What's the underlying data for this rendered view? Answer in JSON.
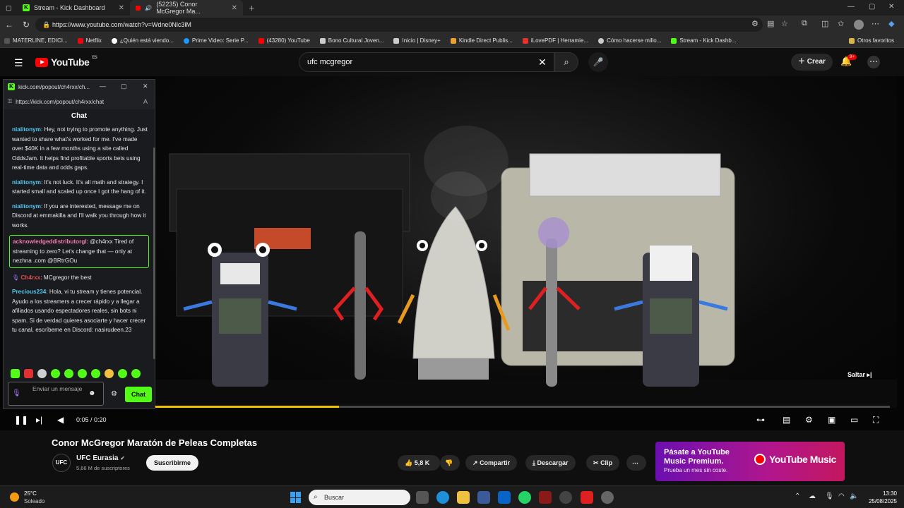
{
  "browser": {
    "tabs": [
      {
        "label": "Stream - Kick Dashboard"
      },
      {
        "label": "(52235) Conor McGregor Ma..."
      }
    ],
    "url": "https://www.youtube.com/watch?v=Wdne0Nlc3lM",
    "bookmarks": [
      {
        "label": "MATERLINE, EDICI...",
        "color": "#ff6b6b"
      },
      {
        "label": "Netflix",
        "color": "#e50914"
      },
      {
        "label": "¿Quién está viendo...",
        "color": "#ffffff"
      },
      {
        "label": "Prime Video: Serie P...",
        "color": "#1a98ff"
      },
      {
        "label": "(43280) YouTube",
        "color": "#ff0000"
      },
      {
        "label": "Bono Cultural Joven...",
        "color": "#cccccc"
      },
      {
        "label": "Inicio | Disney+",
        "color": "#cccccc"
      },
      {
        "label": "Kindle Direct Publis...",
        "color": "#f0a030"
      },
      {
        "label": "iLovePDF | Herramie...",
        "color": "#e5322d"
      },
      {
        "label": "Cómo hacerse millo...",
        "color": "#cccccc"
      },
      {
        "label": "Stream - Kick Dashb...",
        "color": "#53fc18"
      }
    ],
    "other_bookmarks": "Otros favoritos"
  },
  "youtube": {
    "logo": "YouTube",
    "region": "ES",
    "search_query": "ufc mcgregor",
    "create_label": "Crear",
    "notif_count": "9+"
  },
  "player": {
    "time": "0:05 / 0:20",
    "skip_label": "Saltar",
    "progress_fraction": 0.25
  },
  "video": {
    "title": "Conor McGregor Maratón de Peleas Completas",
    "channel": "UFC Eurasia",
    "channel_avatar": "UFC",
    "subscribers": "5,66 M de suscriptores",
    "subscribe_label": "Suscribirme",
    "likes": "5,8 K",
    "share_label": "Compartir",
    "download_label": "Descargar",
    "clip_label": "Clip"
  },
  "promo": {
    "title": "Pásate a YouTube Music Premium.",
    "subtitle": "Prueba un mes sin coste.",
    "logo": "YouTube Music"
  },
  "popup": {
    "title": "kick.com/popout/ch4rxx/ch...",
    "url": "https://kick.com/popout/ch4rxx/chat",
    "chat_title": "Chat",
    "messages": [
      {
        "user": "nialitonym",
        "color": "#53c8f0",
        "text": "Hey, not trying to promote anything. Just wanted to share what's worked for me. I've made over $40K in a few months using a site called OddsJam. It helps find profitable sports bets using real-time data and odds gaps."
      },
      {
        "user": "nialitonym",
        "color": "#53c8f0",
        "text": "It's not luck. It's all math and strategy. I started small and scaled up once I got the hang of it."
      },
      {
        "user": "nialitonym",
        "color": "#53c8f0",
        "text": "If you are interested, message me on Discord at emmakilla and I'll walk you through how it works."
      },
      {
        "user": "acknowledgeddistributorgl",
        "color": "#f07ab0",
        "text": "@ch4rxx Tired of streaming to zero? Let's change that — only at nezhna .com @BRtrGOu"
      },
      {
        "user": "Ch4rxx",
        "color": "#e05050",
        "text": "MCgregor the best"
      },
      {
        "user": "Precious234",
        "color": "#53c8f0",
        "text": "Hola, vi tu stream y tienes potencial. Ayudo a los streamers a crecer rápido y a llegar a afiliados usando espectadores reales, sin bots ni spam. Si de verdad quieres asociarte y hacer crecer tu canal, escríbeme en Discord: nasirudeen.23"
      }
    ],
    "input_placeholder": "Enviar un mensaje",
    "send_label": "Chat"
  },
  "taskbar": {
    "temp": "25°C",
    "weather": "Soleado",
    "search_placeholder": "Buscar",
    "time": "13:30",
    "date": "25/08/2025"
  }
}
